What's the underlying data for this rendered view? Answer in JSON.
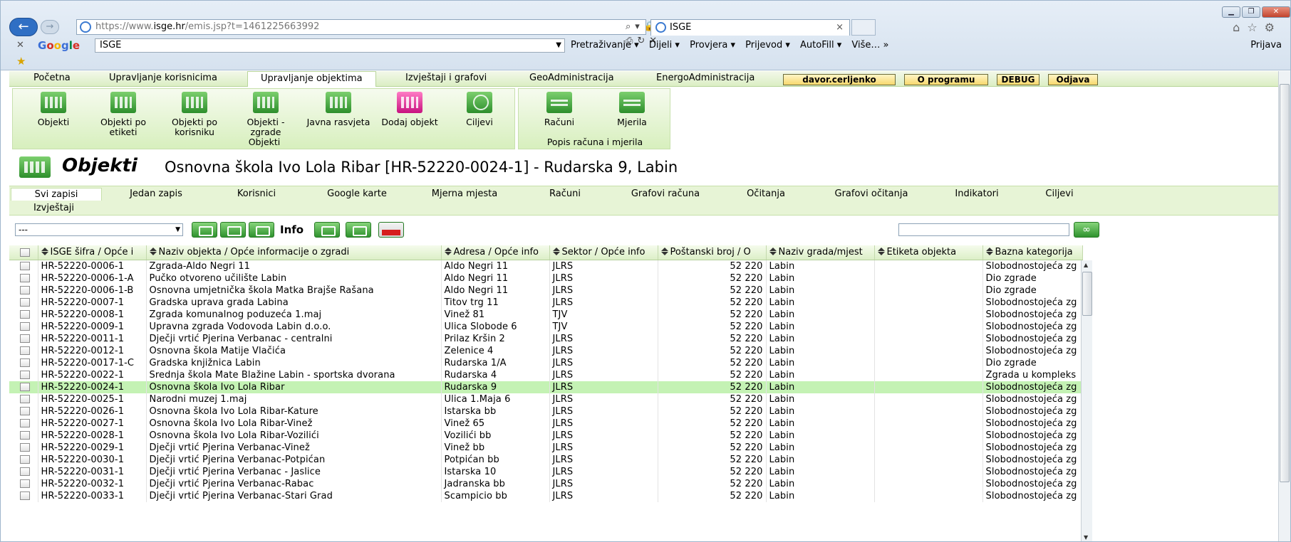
{
  "browser": {
    "url_prefix": "https://www.",
    "url_host": "isge.hr",
    "url_rest": "/emis.jsp?t=1461225663992",
    "tab_title": "ISGE",
    "tab_close": "×",
    "google_label": "Google",
    "google_search": "ISGE",
    "toolbar": [
      "Pretraživanje ▾",
      "Dijeli ▾",
      "Provjera ▾",
      "Prijevod ▾",
      "AutoFill ▾",
      "Više… »"
    ],
    "login": "Prijava"
  },
  "menu": {
    "items": [
      "Početna",
      "Upravljanje korisnicima",
      "Upravljanje objektima",
      "Izvještaji i grafovi",
      "GeoAdministracija",
      "EnergoAdministracija"
    ],
    "user": "davor.cerljenko",
    "about": "O programu",
    "debug": "DEBUG",
    "logout": "Odjava"
  },
  "ribbon": {
    "buttons": [
      "Objekti",
      "Objekti po etiketi",
      "Objekti po korisniku",
      "Objekti - zgrade",
      "Javna rasvjeta",
      "Dodaj objekt",
      "Ciljevi"
    ],
    "group1": "Objekti",
    "buttons2": [
      "Računi",
      "Mjerila"
    ],
    "group2": "Popis računa i mjerila"
  },
  "title": {
    "section": "Objekti",
    "object": "Osnovna škola Ivo Lola Ribar [HR-52220-0024-1] - Rudarska 9, Labin"
  },
  "subtabs": [
    "Svi zapisi",
    "Jedan zapis",
    "Korisnici",
    "Google karte",
    "Mjerna mjesta",
    "Računi",
    "Grafovi računa",
    "Očitanja",
    "Grafovi očitanja",
    "Indikatori",
    "Ciljevi"
  ],
  "subtab_row2": "Izvještaji",
  "filter": {
    "select_value": "---",
    "info_label": "Info"
  },
  "columns": [
    "ISGE šifra / Opće i",
    "Naziv objekta / Opće informacije o zgradi",
    "Adresa / Opće info",
    "Sektor / Opće info",
    "Poštanski broj / O",
    "Naziv grada/mjest",
    "Etiketa objekta",
    "Bazna kategorija"
  ],
  "rows": [
    [
      "HR-52220-0006-1",
      "Zgrada-Aldo Negri 11",
      "Aldo Negri 11",
      "JLRS",
      "52 220",
      "Labin",
      "",
      "Slobodnostojeća zg"
    ],
    [
      "HR-52220-0006-1-A",
      "Pučko otvoreno učilište Labin",
      "Aldo Negri 11",
      "JLRS",
      "52 220",
      "Labin",
      "",
      "Dio zgrade"
    ],
    [
      "HR-52220-0006-1-B",
      "Osnovna umjetnička škola Matka Brajše Rašana",
      "Aldo Negri 11",
      "JLRS",
      "52 220",
      "Labin",
      "",
      "Dio zgrade"
    ],
    [
      "HR-52220-0007-1",
      "Gradska uprava grada Labina",
      "Titov trg 11",
      "JLRS",
      "52 220",
      "Labin",
      "",
      "Slobodnostojeća zg"
    ],
    [
      "HR-52220-0008-1",
      "Zgrada komunalnog poduzeća 1.maj",
      "Vinež 81",
      "TJV",
      "52 220",
      "Labin",
      "",
      "Slobodnostojeća zg"
    ],
    [
      "HR-52220-0009-1",
      "Upravna zgrada Vodovoda Labin d.o.o.",
      "Ulica Slobode 6",
      "TJV",
      "52 220",
      "Labin",
      "",
      "Slobodnostojeća zg"
    ],
    [
      "HR-52220-0011-1",
      "Dječji vrtić Pjerina Verbanac - centralni",
      "Prilaz Kršin 2",
      "JLRS",
      "52 220",
      "Labin",
      "",
      "Slobodnostojeća zg"
    ],
    [
      "HR-52220-0012-1",
      "Osnovna škola Matije Vlačića",
      "Zelenice 4",
      "JLRS",
      "52 220",
      "Labin",
      "",
      "Slobodnostojeća zg"
    ],
    [
      "HR-52220-0017-1-C",
      "Gradska knjižnica Labin",
      "Rudarska 1/A",
      "JLRS",
      "52 220",
      "Labin",
      "",
      "Dio zgrade"
    ],
    [
      "HR-52220-0022-1",
      "Srednja škola Mate Blažine Labin - sportska dvorana",
      "Rudarska 4",
      "JLRS",
      "52 220",
      "Labin",
      "",
      "Zgrada u kompleks"
    ],
    [
      "HR-52220-0024-1",
      "Osnovna škola Ivo Lola Ribar",
      "Rudarska 9",
      "JLRS",
      "52 220",
      "Labin",
      "",
      "Slobodnostojeća zg"
    ],
    [
      "HR-52220-0025-1",
      "Narodni muzej 1.maj",
      "Ulica 1.Maja 6",
      "JLRS",
      "52 220",
      "Labin",
      "",
      "Slobodnostojeća zg"
    ],
    [
      "HR-52220-0026-1",
      "Osnovna škola Ivo Lola Ribar-Kature",
      "Istarska bb",
      "JLRS",
      "52 220",
      "Labin",
      "",
      "Slobodnostojeća zg"
    ],
    [
      "HR-52220-0027-1",
      "Osnovna škola Ivo Lola Ribar-Vinež",
      "Vinež 65",
      "JLRS",
      "52 220",
      "Labin",
      "",
      "Slobodnostojeća zg"
    ],
    [
      "HR-52220-0028-1",
      "Osnovna škola Ivo Lola Ribar-Vozilići",
      "Vozilići bb",
      "JLRS",
      "52 220",
      "Labin",
      "",
      "Slobodnostojeća zg"
    ],
    [
      "HR-52220-0029-1",
      "Dječji vrtić Pjerina Verbanac-Vinež",
      "Vinež bb",
      "JLRS",
      "52 220",
      "Labin",
      "",
      "Slobodnostojeća zg"
    ],
    [
      "HR-52220-0030-1",
      "Dječji vrtić Pjerina Verbanac-Potpićan",
      "Potpićan bb",
      "JLRS",
      "52 220",
      "Labin",
      "",
      "Slobodnostojeća zg"
    ],
    [
      "HR-52220-0031-1",
      "Dječji vrtić Pjerina Verbanac - Jaslice",
      "Istarska 10",
      "JLRS",
      "52 220",
      "Labin",
      "",
      "Slobodnostojeća zg"
    ],
    [
      "HR-52220-0032-1",
      "Dječji vrtić Pjerina Verbanac-Rabac",
      "Jadranska bb",
      "JLRS",
      "52 220",
      "Labin",
      "",
      "Slobodnostojeća zg"
    ],
    [
      "HR-52220-0033-1",
      "Dječji vrtić Pjerina Verbanac-Stari Grad",
      "Scampicio bb",
      "JLRS",
      "52 220",
      "Labin",
      "",
      "Slobodnostojeća zg"
    ]
  ],
  "selected_row_index": 10
}
